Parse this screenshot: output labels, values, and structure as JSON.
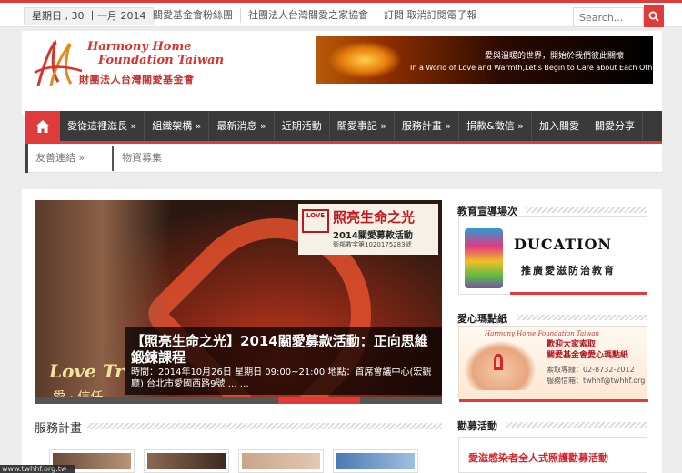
{
  "topbar": {
    "date": "星期日 , 30 十一月 2014",
    "links": [
      "關愛基金會粉絲團",
      "社團法人台灣關愛之家協會",
      "訂閱‧取消訂閱電子報"
    ],
    "search_placeholder": "Search...",
    "accent": "#e03b3b"
  },
  "header": {
    "logo_en_line1": "Harmony Home",
    "logo_en_line2": "Foundation Taiwan",
    "logo_zh": "財團法人台灣關愛基金會",
    "banner_zh": "愛與溫暖的世界，開始於我們彼此關懷",
    "banner_en": "In a World of Love and Warmth,Let's Begin to Care about Each Other."
  },
  "nav": {
    "home_icon": "home-icon",
    "items": [
      "愛從這裡滋長 »",
      "組織架構 »",
      "最新消息 »",
      "近期活動",
      "關愛事記 »",
      "服務計畫 »",
      "捐款&徵信 »",
      "加入關愛",
      "關愛分享"
    ]
  },
  "crumbs": {
    "first": "友善連結 »",
    "second": "物資募集"
  },
  "slider": {
    "sign_badge": "LOVE",
    "sign_title": "照亮生命之光",
    "sign_sub": "2014關愛募款活動",
    "sign_note": "衛部救字第1020175283號",
    "caption_title": "【照亮生命之光】2014關愛募款活動：正向思維鍛鍊課程",
    "caption_meta": "時間：2014年10月26日 星期日 09:00~21:00 地點：首席會議中心(宏觀廳) 台北市愛國西路9號 … …",
    "love_text": "Love Tr",
    "love_text2": "愛 · 信任",
    "progress": 0.2
  },
  "section": {
    "services_title": "服務計畫"
  },
  "statusbar": {
    "url": "www.twhhf.org.tw"
  },
  "sidebar": {
    "edu_title": "教育宣導場次",
    "edu_word": "DUCATION",
    "edu_sub": "推廣愛滋防治教育",
    "card_title": "愛心瑪點紙",
    "card_logo": "Harmony Home Foundation Taiwan",
    "card_line1": "歡迎大家索取",
    "card_line2": "關愛基金會愛心瑪點紙",
    "card_line3": "索取專線：02-8732-2012",
    "card_line4": "服務信箱：twhhf@twhhf.org",
    "fund_title": "勸募活動",
    "fund_text": "愛滋感染者全人式照護勸募活動"
  }
}
